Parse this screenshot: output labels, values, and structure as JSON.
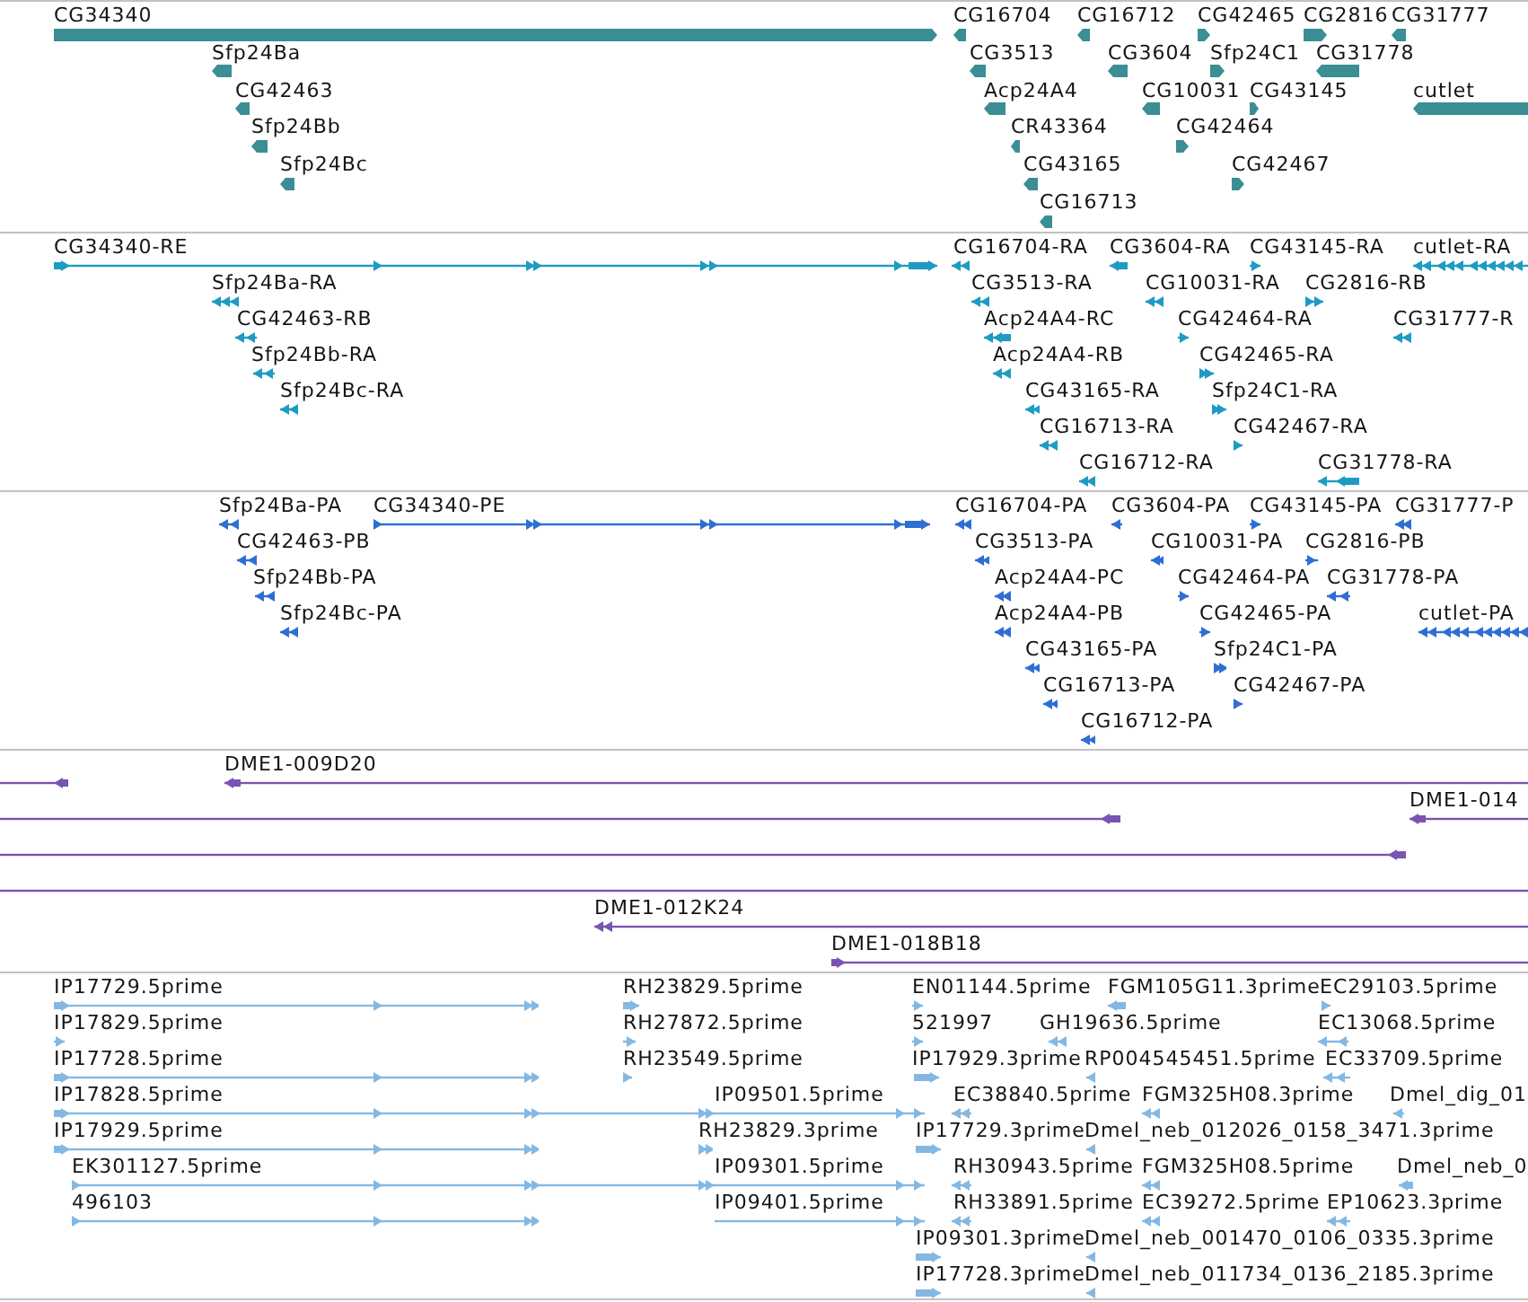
{
  "tracks": [
    {
      "kind": "gene",
      "color": "#3a8e94",
      "features": [
        {
          "label": "CG34340",
          "reverse": false
        },
        {
          "label": "CG16704",
          "reverse": true
        },
        {
          "label": "CG16712",
          "reverse": true
        },
        {
          "label": "CG42465",
          "reverse": false
        },
        {
          "label": "CG2816",
          "reverse": false
        },
        {
          "label": "CG31777",
          "reverse": true
        },
        {
          "label": "Sfp24Ba",
          "reverse": true
        },
        {
          "label": "CG3513",
          "reverse": true
        },
        {
          "label": "CG3604",
          "reverse": true
        },
        {
          "label": "Sfp24C1",
          "reverse": false
        },
        {
          "label": "CG31778",
          "reverse": true
        },
        {
          "label": "CG42463",
          "reverse": true
        },
        {
          "label": "Acp24A4",
          "reverse": true
        },
        {
          "label": "CG10031",
          "reverse": true
        },
        {
          "label": "CG43145",
          "reverse": false
        },
        {
          "label": "cutlet",
          "reverse": true
        },
        {
          "label": "Sfp24Bb",
          "reverse": true
        },
        {
          "label": "CR43364",
          "reverse": true
        },
        {
          "label": "CG42464",
          "reverse": false
        },
        {
          "label": "Sfp24Bc",
          "reverse": true
        },
        {
          "label": "CG43165",
          "reverse": true
        },
        {
          "label": "CG42467",
          "reverse": false
        },
        {
          "label": "CG16713",
          "reverse": true
        }
      ]
    },
    {
      "kind": "transcript",
      "color": "#1d9bc3",
      "features": [
        {
          "label": "CG34340-RE",
          "reverse": false
        },
        {
          "label": "CG16704-RA",
          "reverse": true
        },
        {
          "label": "CG3604-RA",
          "reverse": true
        },
        {
          "label": "CG43145-RA",
          "reverse": false
        },
        {
          "label": "cutlet-RA",
          "reverse": true
        },
        {
          "label": "Sfp24Ba-RA",
          "reverse": true
        },
        {
          "label": "CG3513-RA",
          "reverse": true
        },
        {
          "label": "CG10031-RA",
          "reverse": true
        },
        {
          "label": "CG2816-RB",
          "reverse": false
        },
        {
          "label": "CG42463-RB",
          "reverse": true
        },
        {
          "label": "Acp24A4-RC",
          "reverse": true
        },
        {
          "label": "CG42464-RA",
          "reverse": false
        },
        {
          "label": "CG31777-R",
          "reverse": true
        },
        {
          "label": "Sfp24Bb-RA",
          "reverse": true
        },
        {
          "label": "Acp24A4-RB",
          "reverse": true
        },
        {
          "label": "CG42465-RA",
          "reverse": false
        },
        {
          "label": "Sfp24Bc-RA",
          "reverse": true
        },
        {
          "label": "CG43165-RA",
          "reverse": true
        },
        {
          "label": "Sfp24C1-RA",
          "reverse": false
        },
        {
          "label": "CG16713-RA",
          "reverse": true
        },
        {
          "label": "CG42467-RA",
          "reverse": false
        },
        {
          "label": "CG16712-RA",
          "reverse": true
        },
        {
          "label": "CG31778-RA",
          "reverse": true
        }
      ]
    },
    {
      "kind": "transcript",
      "color": "#2d6fd4",
      "features": [
        {
          "label": "Sfp24Ba-PA",
          "reverse": true
        },
        {
          "label": "CG34340-PE",
          "reverse": false
        },
        {
          "label": "CG16704-PA",
          "reverse": true
        },
        {
          "label": "CG3604-PA",
          "reverse": true
        },
        {
          "label": "CG43145-PA",
          "reverse": false
        },
        {
          "label": "CG31777-P",
          "reverse": true
        },
        {
          "label": "CG42463-PB",
          "reverse": true
        },
        {
          "label": "CG3513-PA",
          "reverse": true
        },
        {
          "label": "CG10031-PA",
          "reverse": true
        },
        {
          "label": "CG2816-PB",
          "reverse": false
        },
        {
          "label": "Sfp24Bb-PA",
          "reverse": true
        },
        {
          "label": "Acp24A4-PC",
          "reverse": true
        },
        {
          "label": "CG42464-PA",
          "reverse": false
        },
        {
          "label": "CG31778-PA",
          "reverse": true
        },
        {
          "label": "Sfp24Bc-PA",
          "reverse": true
        },
        {
          "label": "Acp24A4-PB",
          "reverse": true
        },
        {
          "label": "CG42465-PA",
          "reverse": false
        },
        {
          "label": "cutlet-PA",
          "reverse": true
        },
        {
          "label": "CG43165-PA",
          "reverse": true
        },
        {
          "label": "Sfp24C1-PA",
          "reverse": false
        },
        {
          "label": "CG16713-PA",
          "reverse": true
        },
        {
          "label": "CG42467-PA",
          "reverse": false
        },
        {
          "label": "CG16712-PA",
          "reverse": true
        }
      ]
    },
    {
      "kind": "clone",
      "color": "#7a54b0",
      "features": [
        {
          "kind": "clone",
          "reverse": true
        },
        {
          "kind": "clone",
          "label": "DME1-009D20",
          "reverse": true
        },
        {
          "kind": "clone",
          "reverse": true
        },
        {
          "kind": "clone",
          "label": "DME1-014",
          "reverse": true
        },
        {
          "kind": "clone",
          "reverse": true
        },
        {
          "kind": "line"
        },
        {
          "kind": "clone",
          "label": "DME1-012K24",
          "reverse": true
        },
        {
          "kind": "clone",
          "label": "DME1-018B18",
          "reverse": false
        }
      ]
    },
    {
      "kind": "est",
      "color": "#84b8e2",
      "features": [
        {
          "label": "IP17729.5prime",
          "reverse": false
        },
        {
          "label": "RH23829.5prime",
          "reverse": false
        },
        {
          "label": "EN01144.5prime",
          "reverse": false
        },
        {
          "label": "FGM105G11.3prime",
          "reverse": true
        },
        {
          "label": "EC29103.5prime",
          "reverse": false
        },
        {
          "label": "IP17829.5prime",
          "reverse": false
        },
        {
          "label": "RH27872.5prime",
          "reverse": false
        },
        {
          "label": "521997",
          "reverse": false
        },
        {
          "label": "GH19636.5prime",
          "reverse": true
        },
        {
          "label": "EC13068.5prime",
          "reverse": true
        },
        {
          "label": "IP17728.5prime",
          "reverse": false
        },
        {
          "label": "RH23549.5prime",
          "reverse": false
        },
        {
          "label": "IP17929.3prime",
          "reverse": false
        },
        {
          "label": "RP004545451.5prime",
          "reverse": true
        },
        {
          "label": "EC33709.5prime",
          "reverse": true
        },
        {
          "label": "IP17828.5prime",
          "reverse": false
        },
        {
          "label": "IP09501.5prime",
          "reverse": false
        },
        {
          "label": "EC38840.5prime",
          "reverse": true
        },
        {
          "label": "FGM325H08.3prime",
          "reverse": true
        },
        {
          "label": "Dmel_dig_01",
          "reverse": true
        },
        {
          "label": "IP17929.5prime",
          "reverse": false
        },
        {
          "label": "RH23829.3prime",
          "reverse": false
        },
        {
          "label": "IP17729.3prime",
          "reverse": false
        },
        {
          "label": "Dmel_neb_012026_0158_3471.3prime",
          "reverse": true
        },
        {
          "label": "EK301127.5prime",
          "reverse": false
        },
        {
          "label": "IP09301.5prime",
          "reverse": false
        },
        {
          "label": "RH30943.5prime",
          "reverse": true
        },
        {
          "label": "FGM325H08.5prime",
          "reverse": true
        },
        {
          "label": "Dmel_neb_0",
          "reverse": true
        },
        {
          "label": "496103",
          "reverse": false
        },
        {
          "label": "IP09401.5prime",
          "reverse": false
        },
        {
          "label": "RH33891.5prime",
          "reverse": true
        },
        {
          "label": "EC39272.5prime",
          "reverse": true
        },
        {
          "label": "EP10623.3prime",
          "reverse": true
        },
        {
          "label": "IP09301.3prime",
          "reverse": false
        },
        {
          "label": "Dmel_neb_001470_0106_0335.3prime",
          "reverse": true
        },
        {
          "label": "IP17728.3prime",
          "reverse": false
        },
        {
          "label": "Dmel_neb_011734_0136_2185.3prime",
          "reverse": true
        }
      ]
    }
  ]
}
